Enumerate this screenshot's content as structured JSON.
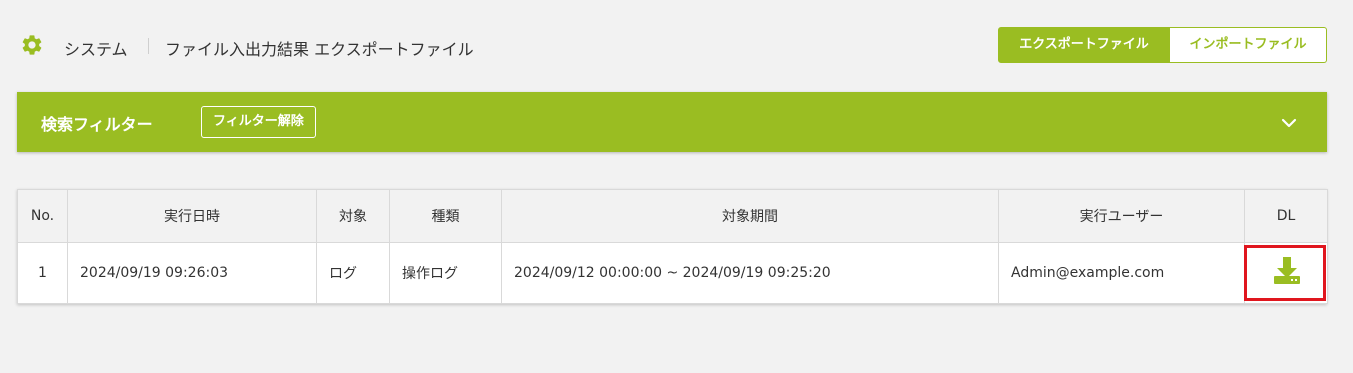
{
  "header": {
    "section": "システム",
    "page_title": "ファイル入出力結果 エクスポートファイル",
    "tabs": [
      {
        "label": "エクスポートファイル",
        "active": true
      },
      {
        "label": "インポートファイル",
        "active": false
      }
    ]
  },
  "filter": {
    "title": "検索フィルター",
    "clear_label": "フィルター解除",
    "toggle_icon": "chevron-down-icon"
  },
  "table": {
    "columns": [
      "No.",
      "実行日時",
      "対象",
      "種類",
      "対象期間",
      "実行ユーザー",
      "DL"
    ],
    "rows": [
      {
        "no": "1",
        "executed_at": "2024/09/19 09:26:03",
        "target": "ログ",
        "kind": "操作ログ",
        "period": "2024/09/12 00:00:00 ~ 2024/09/19 09:25:20",
        "user": "Admin@example.com",
        "dl_icon": "download-icon"
      }
    ]
  },
  "colors": {
    "accent": "#9abd22",
    "highlight": "#e0161e",
    "background": "#f2f2f2"
  }
}
